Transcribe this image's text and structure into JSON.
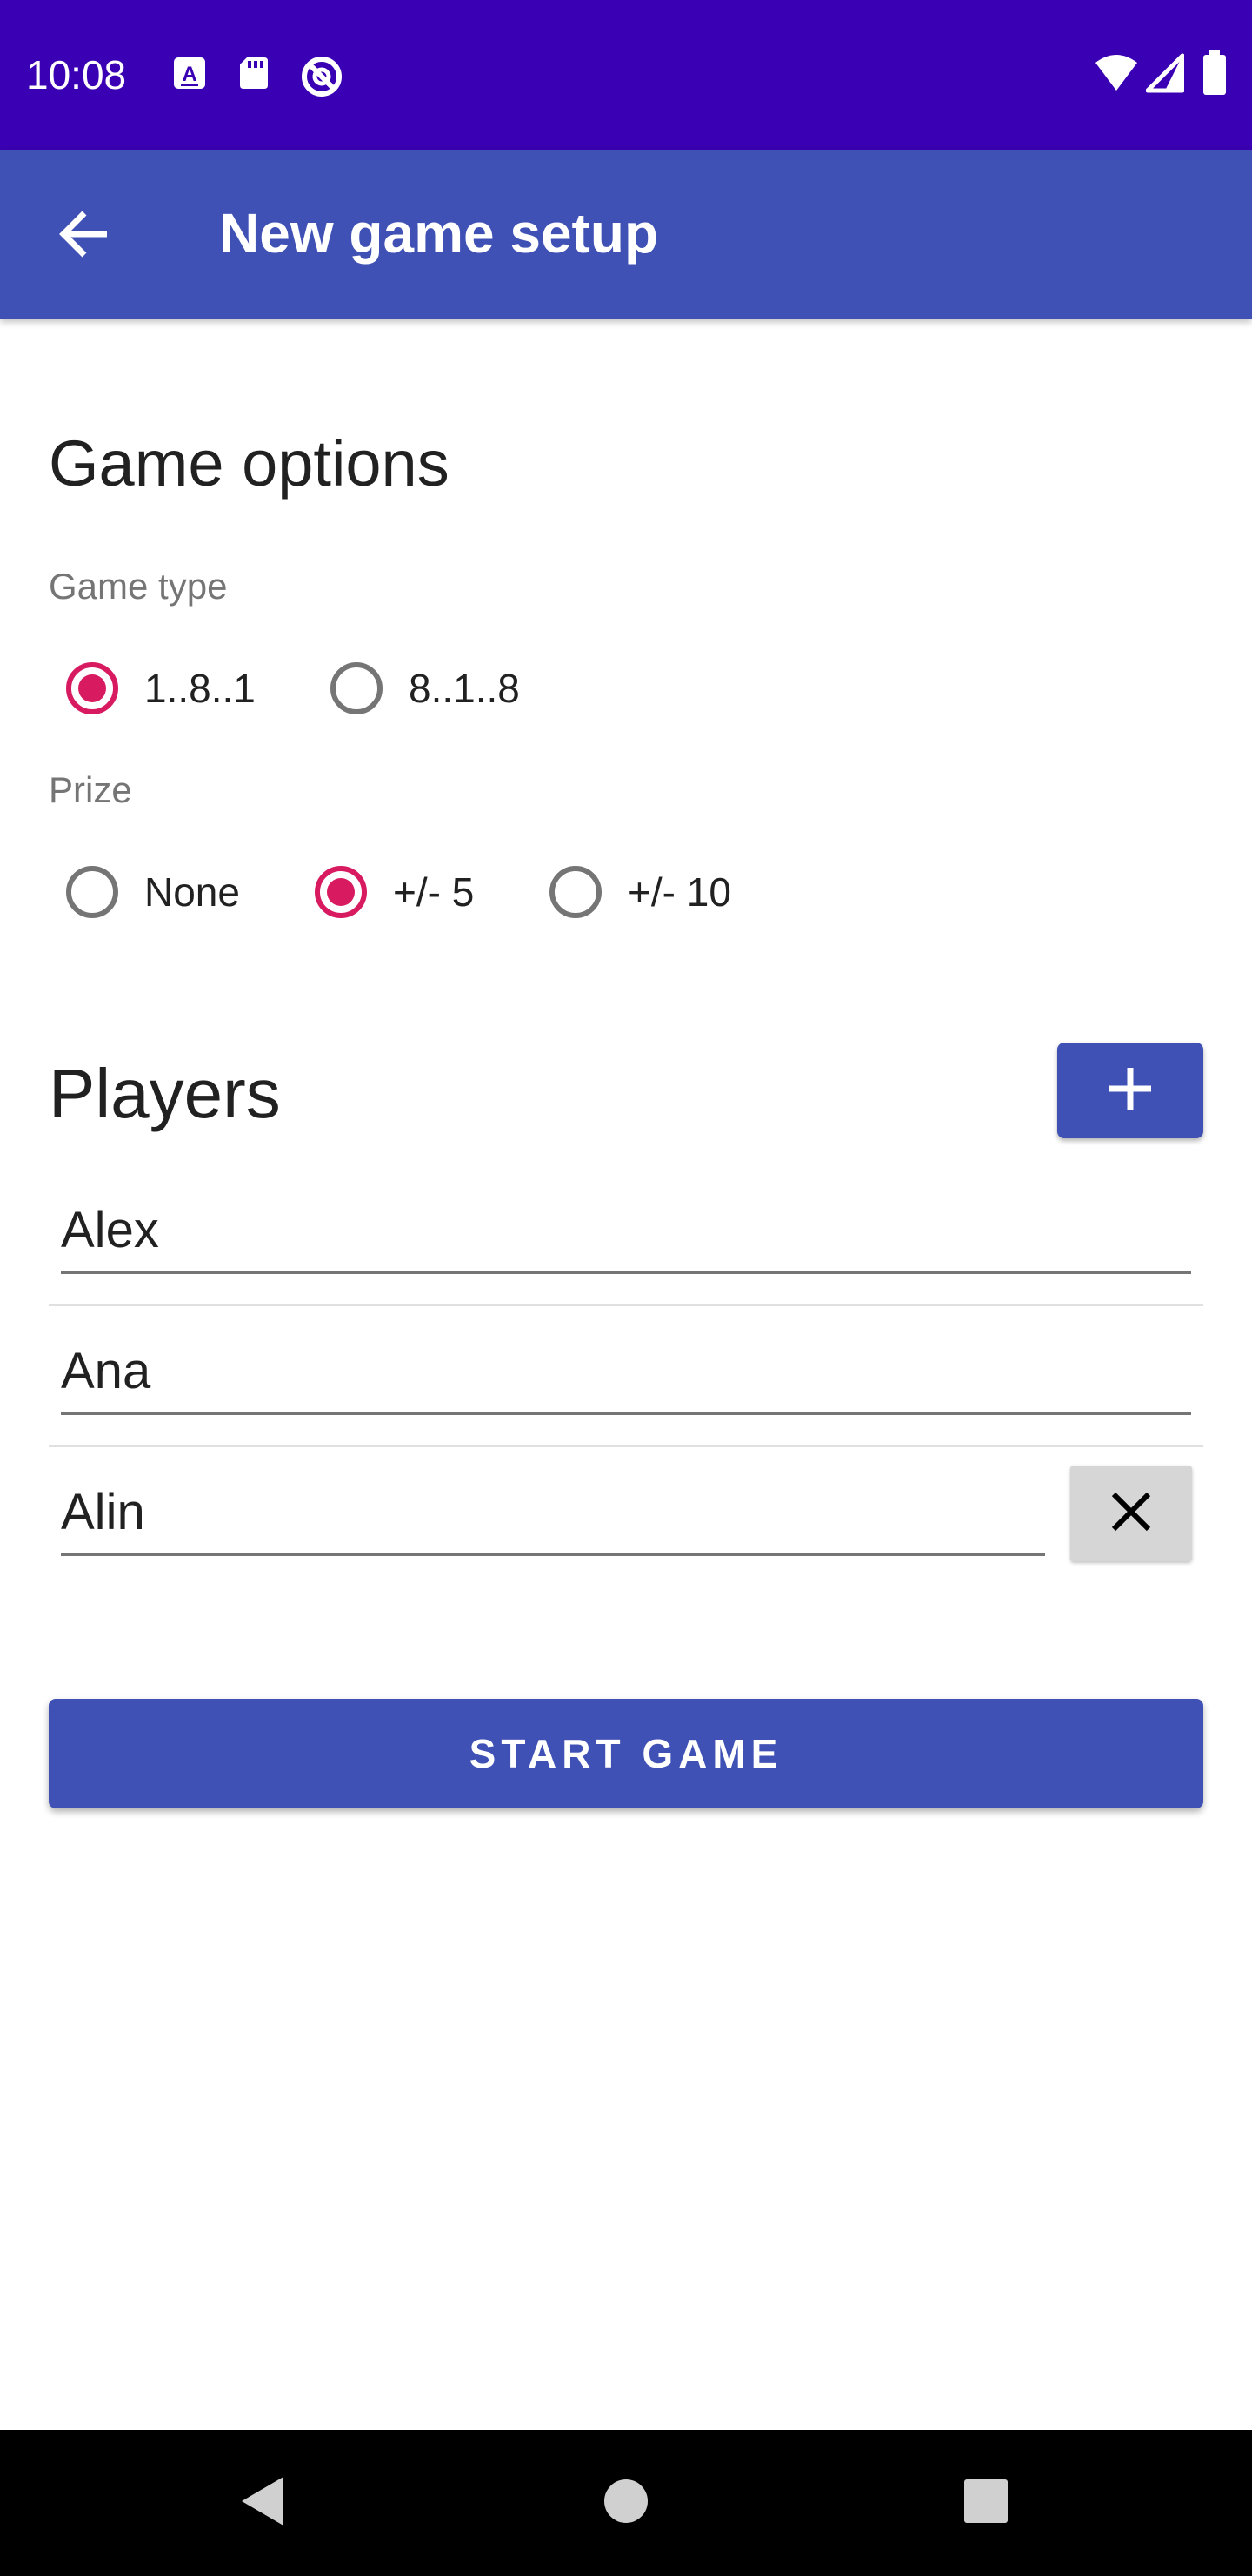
{
  "status_bar": {
    "time": "10:08",
    "icons": [
      "a-notification-icon",
      "sd-card-icon",
      "blocked-icon",
      "wifi-icon",
      "signal-icon",
      "battery-icon"
    ]
  },
  "app_bar": {
    "title": "New game setup",
    "back_icon": "arrow-back-icon"
  },
  "game_options": {
    "title": "Game options",
    "game_type": {
      "label": "Game type",
      "options": [
        {
          "label": "1..8..1",
          "checked": true
        },
        {
          "label": "8..1..8",
          "checked": false
        }
      ]
    },
    "prize": {
      "label": "Prize",
      "options": [
        {
          "label": "None",
          "checked": false
        },
        {
          "label": "+/- 5",
          "checked": true
        },
        {
          "label": "+/- 10",
          "checked": false
        }
      ]
    }
  },
  "players": {
    "title": "Players",
    "add_icon": "plus-icon",
    "list": [
      {
        "name": "Alex"
      },
      {
        "name": "Ana"
      },
      {
        "name": "Alin"
      }
    ],
    "remove_icon": "close-icon"
  },
  "start_button": {
    "label": "START GAME"
  },
  "nav_bar": {
    "icons": [
      "back-triangle-icon",
      "home-circle-icon",
      "recents-square-icon"
    ]
  },
  "colors": {
    "status_bar": "#3a00b3",
    "primary": "#3f51b5",
    "accent": "#d81b60"
  }
}
